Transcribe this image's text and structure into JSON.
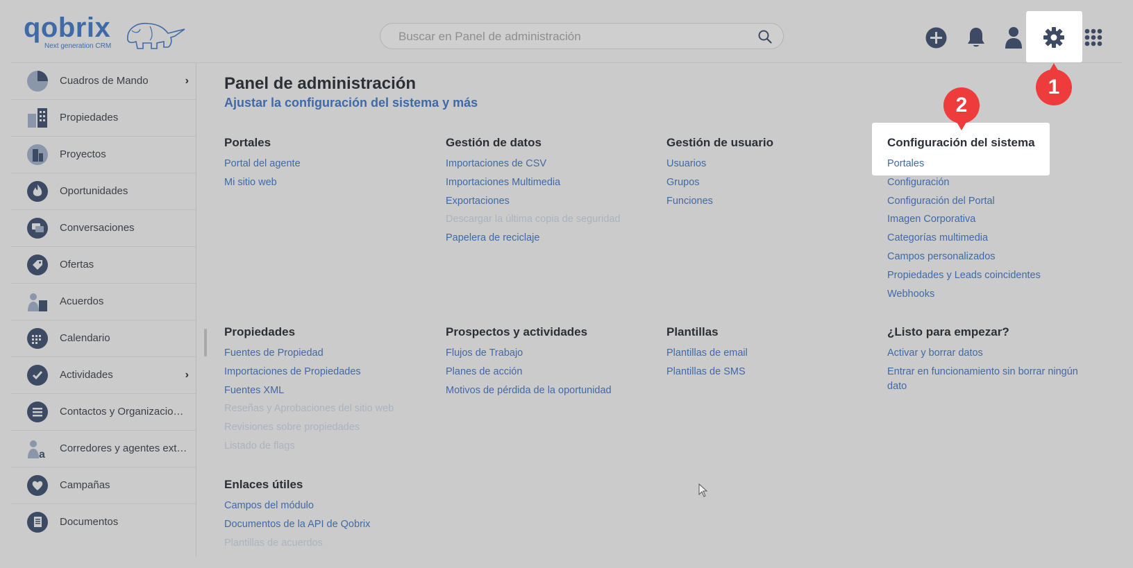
{
  "header": {
    "logo_text": "qobrix",
    "logo_tagline": "Next generation CRM",
    "search_placeholder": "Buscar en Panel de administración",
    "icons": [
      "plus-circle-icon",
      "bell-icon",
      "user-icon",
      "gear-icon",
      "apps-grid-icon"
    ]
  },
  "markers": {
    "one": "1",
    "two": "2"
  },
  "sidebar": {
    "items": [
      {
        "label": "Cuadros de Mando",
        "icon": "pie-chart-icon",
        "chevron": "›"
      },
      {
        "label": "Propiedades",
        "icon": "building-icon"
      },
      {
        "label": "Proyectos",
        "icon": "project-icon"
      },
      {
        "label": "Oportunidades",
        "icon": "flame-icon"
      },
      {
        "label": "Conversaciones",
        "icon": "chat-icon"
      },
      {
        "label": "Ofertas",
        "icon": "tag-icon"
      },
      {
        "label": "Acuerdos",
        "icon": "agreement-icon"
      },
      {
        "label": "Calendario",
        "icon": "calendar-icon"
      },
      {
        "label": "Actividades",
        "icon": "check-icon",
        "chevron": "›"
      },
      {
        "label": "Contactos y Organizaciones",
        "icon": "contacts-icon"
      },
      {
        "label": "Corredores y agentes exte…",
        "icon": "broker-icon"
      },
      {
        "label": "Campañas",
        "icon": "heart-icon"
      },
      {
        "label": "Documentos",
        "icon": "document-icon"
      }
    ]
  },
  "main": {
    "title": "Panel de administración",
    "subtitle": "Ajustar la configuración del sistema y más",
    "sections": {
      "portales": {
        "title": "Portales",
        "links": [
          "Portal del agente",
          "Mi sitio web"
        ]
      },
      "datos": {
        "title": "Gestión de datos",
        "links": [
          "Importaciones de CSV",
          "Importaciones Multimedia",
          "Exportaciones",
          "Descargar la última copia de seguridad",
          "Papelera de reciclaje"
        ]
      },
      "usuario": {
        "title": "Gestión de usuario",
        "links": [
          "Usuarios",
          "Grupos",
          "Funciones"
        ]
      },
      "sistema": {
        "title": "Configuración del sistema",
        "links": [
          "Portales",
          "Configuración",
          "Configuración del Portal",
          "Imagen Corporativa",
          "Categorías multimedia",
          "Campos personalizados",
          "Propiedades y Leads coincidentes",
          "Webhooks"
        ]
      },
      "propiedades": {
        "title": "Propiedades",
        "links": [
          "Fuentes de Propiedad",
          "Importaciones de Propiedades",
          "Fuentes XML",
          "Reseñas y Aprobaciones del sitio web",
          "Revisiones sobre propiedades",
          "Listado de flags"
        ]
      },
      "prospectos": {
        "title": "Prospectos y actividades",
        "links": [
          "Flujos de Trabajo",
          "Planes de acción",
          "Motivos de pérdida de la oportunidad"
        ]
      },
      "plantillas": {
        "title": "Plantillas",
        "links": [
          "Plantillas de email",
          "Plantillas de SMS"
        ]
      },
      "listo": {
        "title": "¿Listo para empezar?",
        "links": [
          "Activar y borrar datos",
          "Entrar en funcionamiento sin borrar ningún dato"
        ]
      },
      "enlaces": {
        "title": "Enlaces útiles",
        "links": [
          "Campos del módulo",
          "Documentos de la API de Qobrix",
          "Plantillas de acuerdos"
        ]
      }
    }
  },
  "colors": {
    "accent": "#3f6aa6",
    "marker": "#ee3b3b",
    "disabled_link": "#a9b3c0",
    "icon": "#3c4a63"
  }
}
